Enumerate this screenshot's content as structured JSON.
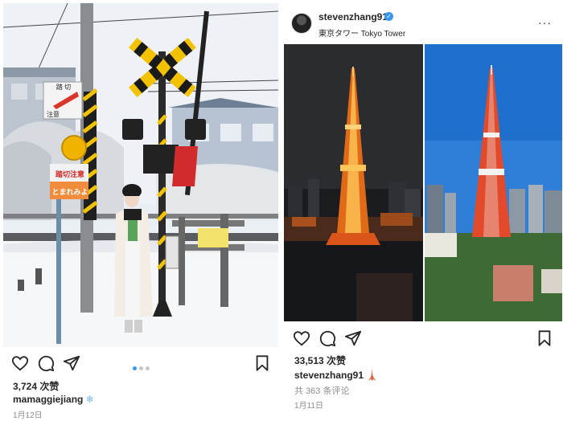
{
  "left_post": {
    "likes": "3,724 次赞",
    "username": "mamaggiejiang",
    "username_emoji": "❄",
    "date": "1月12日",
    "carousel_dots": 3,
    "sign_line1": "踏切注意",
    "sign_line2": "とまれみよ",
    "sign_top_line1": "踏 切",
    "sign_top_line2": "注意"
  },
  "right_post": {
    "username": "stevenzhang91",
    "verified_icon": "✓",
    "location": "東京タワー  Tokyo Tower",
    "more_icon": "···",
    "likes": "33,513 次赞",
    "caption_username": "stevenzhang91",
    "caption_emoji": "🗼",
    "comments": "共 363 条评论",
    "date": "1月11日"
  },
  "icons": [
    "heart-icon",
    "comment-icon",
    "share-icon",
    "bookmark-icon",
    "more-icon",
    "verified-icon"
  ]
}
